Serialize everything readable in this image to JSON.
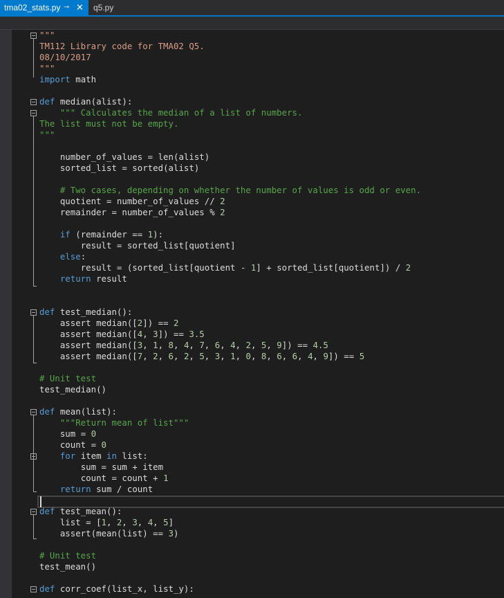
{
  "tabs": [
    {
      "label": "tma02_stats.py",
      "pin": "⊸",
      "close": "✕",
      "active": true
    },
    {
      "label": "q5.py",
      "active": false
    }
  ],
  "code_lines": [
    "\"\"\"",
    "TM112 Library code for TMA02 Q5.",
    "08/10/2017",
    "\"\"\"",
    "import math",
    "",
    "def median(alist):",
    "    \"\"\" Calculates the median of a list of numbers.",
    "The list must not be empty.",
    "\"\"\"",
    "",
    "    number_of_values = len(alist)",
    "    sorted_list = sorted(alist)",
    "",
    "    # Two cases, depending on whether the number of values is odd or even.",
    "    quotient = number_of_values // 2",
    "    remainder = number_of_values % 2",
    "",
    "    if (remainder == 1):",
    "        result = sorted_list[quotient]",
    "    else:",
    "        result = (sorted_list[quotient - 1] + sorted_list[quotient]) / 2",
    "    return result",
    "",
    "",
    "def test_median():",
    "    assert median([2]) == 2",
    "    assert median([4, 3]) == 3.5",
    "    assert median([3, 1, 8, 4, 7, 6, 4, 2, 5, 9]) == 4.5",
    "    assert median([7, 2, 6, 2, 5, 3, 1, 0, 8, 6, 6, 4, 9]) == 5",
    "",
    "# Unit test",
    "test_median()",
    "",
    "def mean(list):",
    "    \"\"\"Return mean of list\"\"\"",
    "    sum = 0",
    "    count = 0",
    "    for item in list:",
    "        sum = sum + item",
    "        count = count + 1",
    "    return sum / count",
    "",
    "def test_mean():",
    "    list = [1, 2, 3, 4, 5]",
    "    assert(mean(list) == 3)",
    "",
    "# Unit test",
    "test_mean()",
    "",
    "def corr_coef(list_x, list_y):"
  ],
  "colors": {
    "accent": "#007acc",
    "background": "#1e1e1e",
    "keyword": "#569cd6",
    "string": "#d69d85",
    "comment": "#57a64a",
    "number": "#b5cea8",
    "text": "#dcdcdc"
  }
}
